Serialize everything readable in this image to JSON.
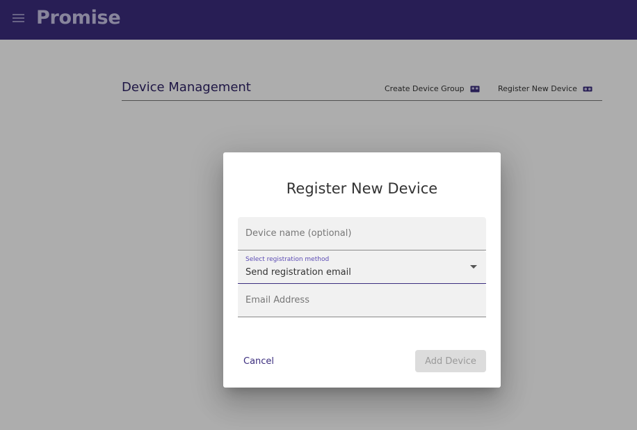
{
  "app": {
    "title": "Promise",
    "menu_icon": "menu-icon"
  },
  "page": {
    "title": "Device Management",
    "actions": {
      "create_group": {
        "label": "Create Device Group",
        "icon": "device-group-icon"
      },
      "register_device": {
        "label": "Register New Device",
        "icon": "device-icon"
      }
    }
  },
  "dialog": {
    "title": "Register New Device",
    "device_name": {
      "placeholder": "Device name (optional)",
      "value": ""
    },
    "registration_method": {
      "label": "Select registration method",
      "selected": "Send registration email"
    },
    "email": {
      "placeholder": "Email Address",
      "value": ""
    },
    "cancel_label": "Cancel",
    "add_label": "Add Device"
  },
  "colors": {
    "primary": "#3b2d7e",
    "scrim": "rgba(0,0,0,0.32)",
    "field_bg": "#f1f1f1"
  }
}
